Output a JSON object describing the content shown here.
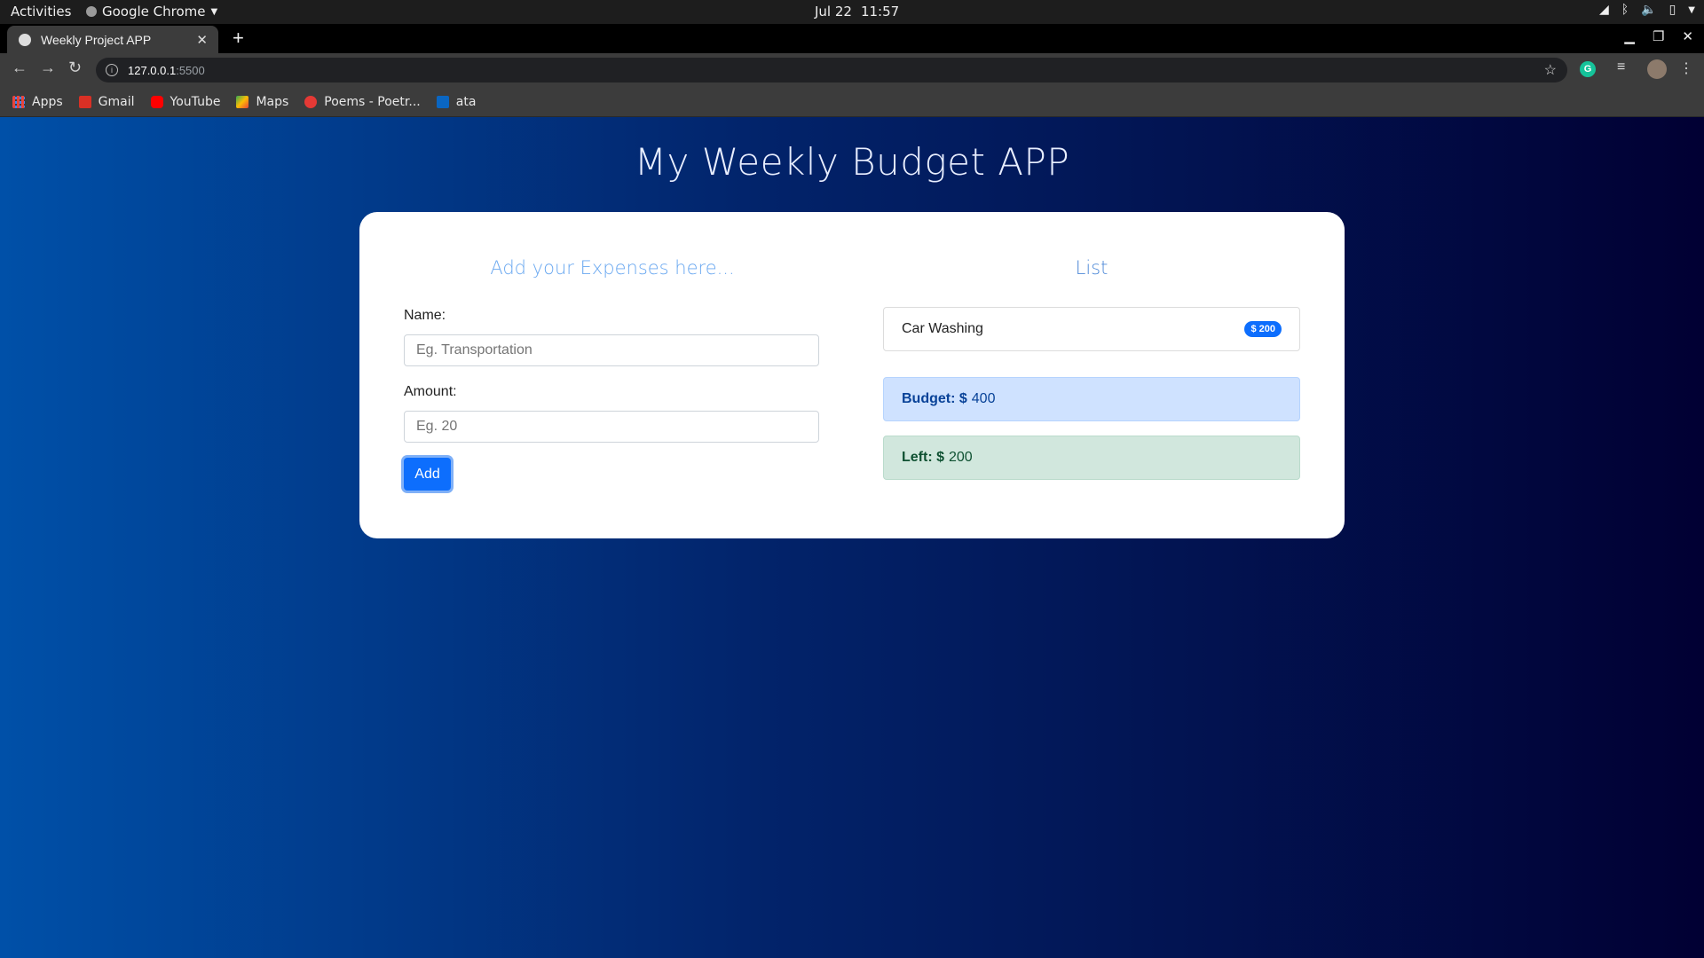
{
  "system_bar": {
    "activities": "Activities",
    "app_name": "Google Chrome",
    "date": "Jul 22",
    "time": "11:57"
  },
  "browser": {
    "tab_title": "Weekly Project APP",
    "url_host": "127.0.0.1",
    "url_port": ":5500",
    "bookmarks": [
      {
        "label": "Apps",
        "icon": "apps-grid-icon",
        "color": "#e8453c"
      },
      {
        "label": "Gmail",
        "icon": "gmail-icon",
        "color": "#d93025"
      },
      {
        "label": "YouTube",
        "icon": "youtube-icon",
        "color": "#ff0000"
      },
      {
        "label": "Maps",
        "icon": "maps-icon",
        "color": "#34a853"
      },
      {
        "label": "Poems - Poetr...",
        "icon": "poems-icon",
        "color": "#e53935"
      },
      {
        "label": "ata",
        "icon": "linkedin-icon",
        "color": "#0a66c2"
      }
    ]
  },
  "app": {
    "title": "My Weekly Budget APP",
    "form": {
      "heading": "Add your Expenses here...",
      "name_label": "Name:",
      "name_placeholder": "Eg. Transportation",
      "amount_label": "Amount:",
      "amount_placeholder": "Eg. 20",
      "add_label": "Add"
    },
    "list": {
      "heading": "List",
      "items": [
        {
          "name": "Car Washing",
          "amount": "$ 200"
        }
      ]
    },
    "budget": {
      "label": "Budget: $",
      "value": "400"
    },
    "left": {
      "label": "Left: $",
      "value": "200"
    }
  },
  "colors": {
    "primary": "#0d6efd",
    "background_start": "#0050a8",
    "background_end": "#010033"
  }
}
